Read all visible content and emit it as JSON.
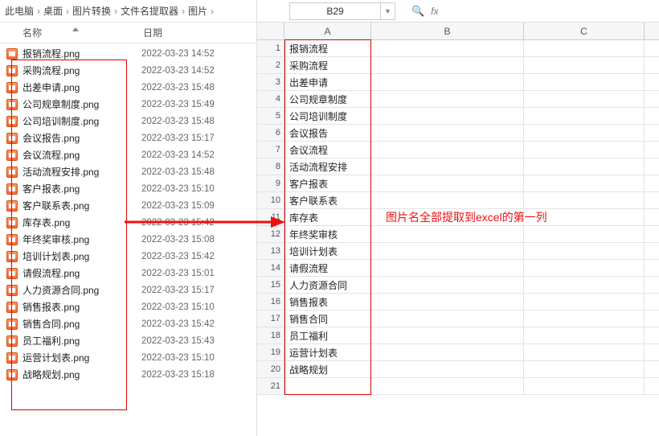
{
  "breadcrumb": [
    "此电脑",
    "桌面",
    "图片转换",
    "文件名提取器",
    "图片"
  ],
  "explorer_headers": {
    "name": "名称",
    "date": "日期"
  },
  "files": [
    {
      "name": "报销流程.png",
      "date": "2022-03-23 14:52"
    },
    {
      "name": "采购流程.png",
      "date": "2022-03-23 14:52"
    },
    {
      "name": "出差申请.png",
      "date": "2022-03-23 15:48"
    },
    {
      "name": "公司规章制度.png",
      "date": "2022-03-23 15:49"
    },
    {
      "name": "公司培训制度.png",
      "date": "2022-03-23 15:48"
    },
    {
      "name": "会议报告.png",
      "date": "2022-03-23 15:17"
    },
    {
      "name": "会议流程.png",
      "date": "2022-03-23 14:52"
    },
    {
      "name": "活动流程安排.png",
      "date": "2022-03-23 15:48"
    },
    {
      "name": "客户报表.png",
      "date": "2022-03-23 15:10"
    },
    {
      "name": "客户联系表.png",
      "date": "2022-03-23 15:09"
    },
    {
      "name": "库存表.png",
      "date": "2022-03-23 15:42"
    },
    {
      "name": "年终奖审核.png",
      "date": "2022-03-23 15:08"
    },
    {
      "name": "培训计划表.png",
      "date": "2022-03-23 15:42"
    },
    {
      "name": "请假流程.png",
      "date": "2022-03-23 15:01"
    },
    {
      "name": "人力资源合同.png",
      "date": "2022-03-23 15:17"
    },
    {
      "name": "销售报表.png",
      "date": "2022-03-23 15:10"
    },
    {
      "name": "销售合同.png",
      "date": "2022-03-23 15:42"
    },
    {
      "name": "员工福利.png",
      "date": "2022-03-23 15:43"
    },
    {
      "name": "运营计划表.png",
      "date": "2022-03-23 15:10"
    },
    {
      "name": "战略规划.png",
      "date": "2022-03-23 15:18"
    }
  ],
  "sheet": {
    "cell_ref": "B29",
    "fx_label": "fx",
    "columns": [
      "A",
      "B",
      "C"
    ],
    "totalRows": 21,
    "data_A": [
      "报销流程",
      "采购流程",
      "出差申请",
      "公司规章制度",
      "公司培训制度",
      "会议报告",
      "会议流程",
      "活动流程安排",
      "客户报表",
      "客户联系表",
      "库存表",
      "年终奖审核",
      "培训计划表",
      "请假流程",
      "人力资源合同",
      "销售报表",
      "销售合同",
      "员工福利",
      "运营计划表",
      "战略规划"
    ]
  },
  "annotation": "图片名全部提取到excel的第一列"
}
